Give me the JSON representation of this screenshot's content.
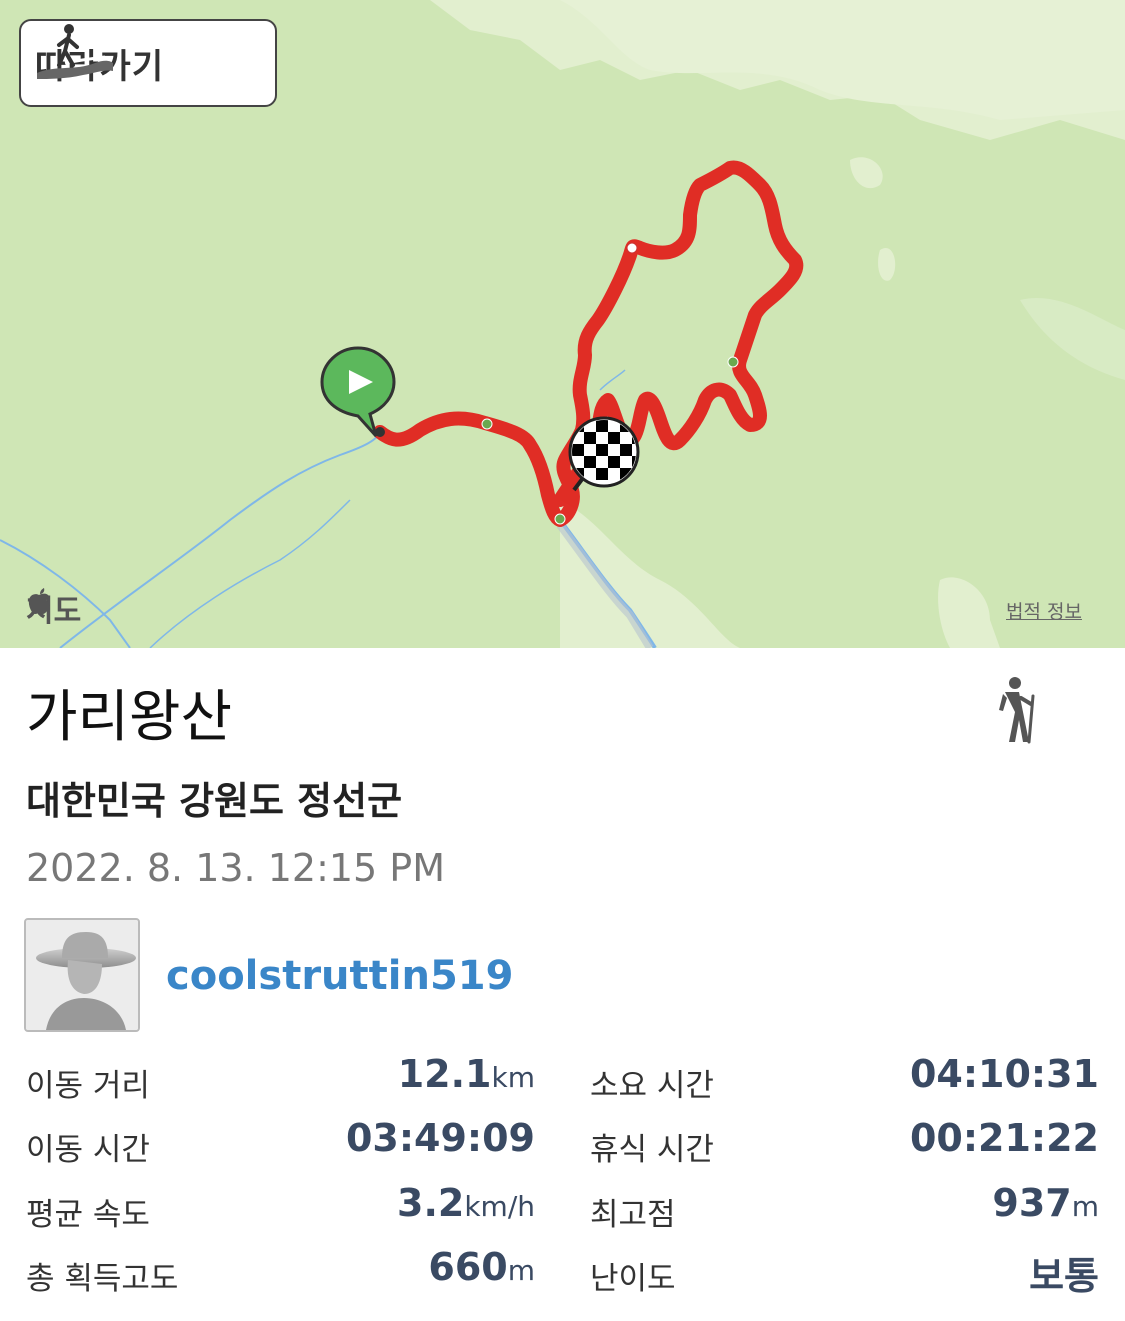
{
  "map": {
    "follow_button_label": "따라가기",
    "brand_label": "지도",
    "legal_link_label": "법적 정보",
    "colors": {
      "land": "#cfe6b5",
      "route": "#e0231e",
      "river": "#7fb7e8"
    }
  },
  "activity": {
    "title": "가리왕산",
    "location": "대한민국 강원도 정선군",
    "datetime": "2022. 8. 13. 12:15 PM",
    "type_icon": "hiker-icon"
  },
  "user": {
    "username": "coolstruttin519",
    "avatar_icon": "default-avatar-hat"
  },
  "stats": {
    "distance": {
      "label": "이동 거리",
      "value": "12.1",
      "unit": "km"
    },
    "moving_time": {
      "label": "이동 시간",
      "value": "03:49:09",
      "unit": ""
    },
    "avg_speed": {
      "label": "평균 속도",
      "value": "3.2",
      "unit": "km/h"
    },
    "elevation_gain": {
      "label": "총 획득고도",
      "value": "660",
      "unit": "m"
    },
    "total_time": {
      "label": "소요 시간",
      "value": "04:10:31",
      "unit": ""
    },
    "rest_time": {
      "label": "휴식 시간",
      "value": "00:21:22",
      "unit": ""
    },
    "max_elevation": {
      "label": "최고점",
      "value": "937",
      "unit": "m"
    },
    "difficulty": {
      "label": "난이도",
      "value": "보통",
      "unit": ""
    }
  }
}
